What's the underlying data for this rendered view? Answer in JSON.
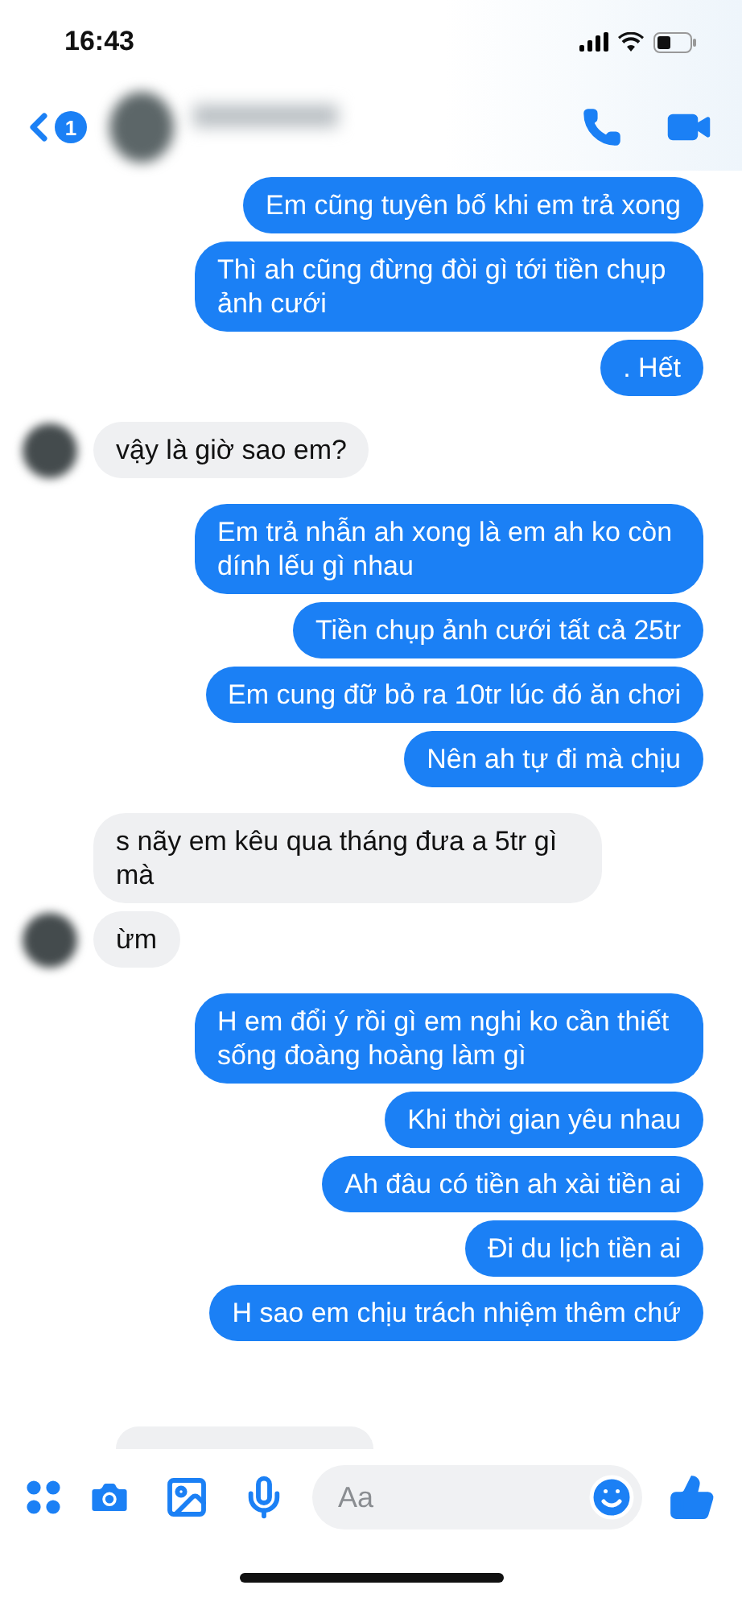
{
  "status_bar": {
    "time": "16:43"
  },
  "header": {
    "unread_count": "1"
  },
  "messages": [
    {
      "kind": "sent",
      "text": "Em cũng tuyên bố khi em trả xong"
    },
    {
      "kind": "sent",
      "text": "Thì ah cũng đừng đòi gì tới tiền chụp ảnh cưới"
    },
    {
      "kind": "sent",
      "text": ". Hết"
    },
    {
      "kind": "received",
      "text": "vậy là giờ sao em?",
      "show_avatar": true
    },
    {
      "kind": "sent",
      "text": "Em trả nhẫn ah xong là em ah ko còn dính lếu gì nhau"
    },
    {
      "kind": "sent",
      "text": "Tiền chụp ảnh cưới tất cả 25tr"
    },
    {
      "kind": "sent",
      "text": "Em cung đữ bỏ ra 10tr lúc đó ăn chơi"
    },
    {
      "kind": "sent",
      "text": "Nên ah tự đi mà chịu"
    },
    {
      "kind": "received",
      "text": "s nãy em kêu qua tháng đưa a 5tr gì mà",
      "show_avatar": false
    },
    {
      "kind": "received",
      "text": "ừm",
      "show_avatar": true
    },
    {
      "kind": "sent",
      "text": "H em đổi ý rồi gì em nghi ko cần thiết sống đoàng hoàng làm gì"
    },
    {
      "kind": "sent",
      "text": "Khi thời gian yêu nhau"
    },
    {
      "kind": "sent",
      "text": "Ah đâu có tiền ah xài tiền ai"
    },
    {
      "kind": "sent",
      "text": "Đi du lịch tiền ai"
    },
    {
      "kind": "sent",
      "text": "H sao em chịu trách nhiệm thêm chứ"
    }
  ],
  "composer": {
    "placeholder": "Aa"
  }
}
